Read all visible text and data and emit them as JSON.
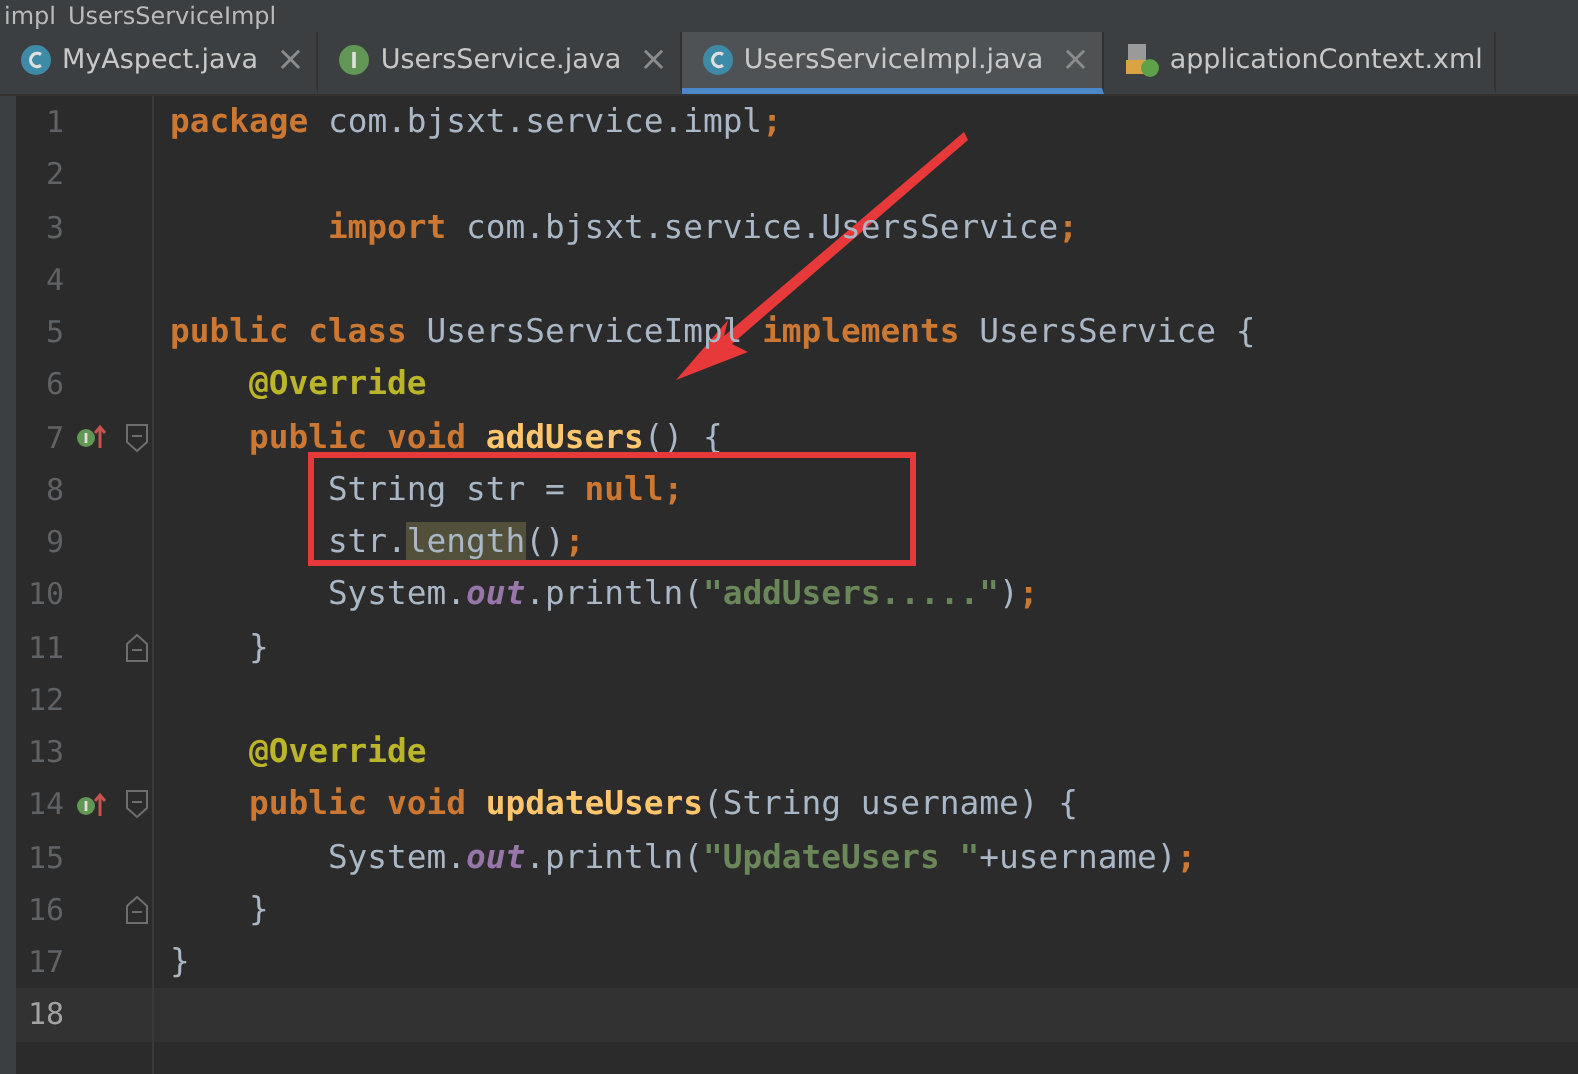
{
  "breadcrumb": [
    "impl",
    "UsersServiceImpl"
  ],
  "tabs": [
    {
      "label": "MyAspect.java",
      "kind": "class",
      "selected": false,
      "closable": true
    },
    {
      "label": "UsersService.java",
      "kind": "interface",
      "selected": false,
      "closable": true
    },
    {
      "label": "UsersServiceImpl.java",
      "kind": "class",
      "selected": true,
      "closable": true
    },
    {
      "label": "applicationContext.xml",
      "kind": "xml",
      "selected": false,
      "closable": false
    }
  ],
  "close_glyph": "×",
  "lines": [
    {
      "number": "1",
      "current": false,
      "tokens": [
        {
          "kind": "kw",
          "text": "package "
        },
        {
          "kind": "text",
          "text": "com.bjsxt.service.impl"
        },
        {
          "kind": "punct",
          "text": ";"
        }
      ]
    },
    {
      "number": "2",
      "current": false
    },
    {
      "number": "3",
      "current": false,
      "tokens": [
        {
          "kind": "kw",
          "text": "        import "
        },
        {
          "kind": "text",
          "text": "com.bjsxt.service.UsersService"
        },
        {
          "kind": "punct",
          "text": ";"
        }
      ]
    },
    {
      "number": "4",
      "current": false
    },
    {
      "number": "5",
      "current": false,
      "tokens": [
        {
          "kind": "kw",
          "text": "public class "
        },
        {
          "kind": "text",
          "text": "UsersServiceImpl "
        },
        {
          "kind": "kw",
          "text": "implements "
        },
        {
          "kind": "text",
          "text": "UsersService {"
        }
      ]
    },
    {
      "number": "6",
      "current": false,
      "tokens": [
        {
          "kind": "anno",
          "text": "    @Override"
        }
      ]
    },
    {
      "number": "7",
      "current": false,
      "overrides": true,
      "fold_start": true,
      "tokens": [
        {
          "kind": "kw",
          "text": "    public void "
        },
        {
          "kind": "fn",
          "text": "addUsers"
        },
        {
          "kind": "text",
          "text": "() {"
        }
      ]
    },
    {
      "number": "8",
      "current": false,
      "tokens": [
        {
          "kind": "text",
          "text": "        String str = "
        },
        {
          "kind": "kw",
          "text": "null"
        },
        {
          "kind": "punct",
          "text": ";"
        }
      ]
    },
    {
      "number": "9",
      "current": false,
      "tokens": [
        {
          "kind": "text",
          "text": "        str."
        },
        {
          "kind": "usage",
          "text": "length"
        },
        {
          "kind": "text",
          "text": "()"
        },
        {
          "kind": "punct",
          "text": ";"
        }
      ]
    },
    {
      "number": "10",
      "current": false,
      "tokens": [
        {
          "kind": "text",
          "text": "        System."
        },
        {
          "kind": "field",
          "text": "out"
        },
        {
          "kind": "text",
          "text": ".println("
        },
        {
          "kind": "str",
          "text": "\"addUsers.....\""
        },
        {
          "kind": "text",
          "text": ")"
        },
        {
          "kind": "punct",
          "text": ";"
        }
      ]
    },
    {
      "number": "11",
      "current": false,
      "fold_end": true,
      "tokens": [
        {
          "kind": "text",
          "text": "    }"
        }
      ]
    },
    {
      "number": "12",
      "current": false
    },
    {
      "number": "13",
      "current": false,
      "tokens": [
        {
          "kind": "anno",
          "text": "    @Override"
        }
      ]
    },
    {
      "number": "14",
      "current": false,
      "overrides": true,
      "fold_start": true,
      "tokens": [
        {
          "kind": "kw",
          "text": "    public void "
        },
        {
          "kind": "fn",
          "text": "updateUsers"
        },
        {
          "kind": "text",
          "text": "(String username) {"
        }
      ]
    },
    {
      "number": "15",
      "current": false,
      "tokens": [
        {
          "kind": "text",
          "text": "        System."
        },
        {
          "kind": "field",
          "text": "out"
        },
        {
          "kind": "text",
          "text": ".println("
        },
        {
          "kind": "str",
          "text": "\"UpdateUsers \""
        },
        {
          "kind": "text",
          "text": "+username)"
        },
        {
          "kind": "punct",
          "text": ";"
        }
      ]
    },
    {
      "number": "16",
      "current": false,
      "fold_end": true,
      "tokens": [
        {
          "kind": "text",
          "text": "    }"
        }
      ]
    },
    {
      "number": "17",
      "current": false,
      "tokens": [
        {
          "kind": "text",
          "text": "}"
        }
      ]
    },
    {
      "number": "18",
      "current": true
    }
  ]
}
